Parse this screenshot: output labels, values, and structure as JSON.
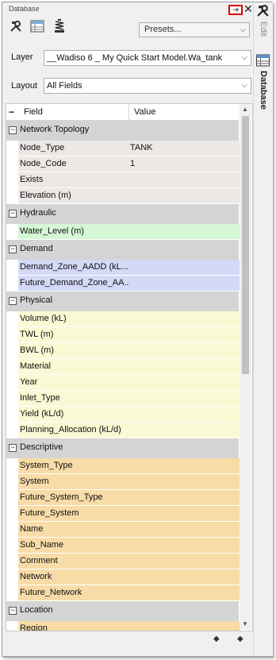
{
  "panel": {
    "title": "Database",
    "pin_symbol": "⇥",
    "close_symbol": "✕",
    "toolbar_icons": [
      "tools-icon",
      "table-icon",
      "spring-icon"
    ],
    "presets_label": "Presets...",
    "layer_label": "Layer",
    "layer_value": "__Wadiso 6 _ My Quick Start Model.Wa_tank",
    "layout_label": "Layout",
    "layout_value": "All Fields"
  },
  "grid": {
    "headers": {
      "collapse": "−",
      "field": "Field",
      "value": "Value"
    },
    "groups": [
      {
        "name": "Network Topology",
        "color": "#ece8e6",
        "rows": [
          {
            "field": "Node_Type",
            "value": "TANK"
          },
          {
            "field": "Node_Code",
            "value": "1"
          },
          {
            "field": "Exists",
            "value": ""
          },
          {
            "field": "Elevation (m)",
            "value": ""
          }
        ]
      },
      {
        "name": "Hydraulic",
        "color": "#d6f7d6",
        "rows": [
          {
            "field": "Water_Level (m)",
            "value": ""
          }
        ]
      },
      {
        "name": "Demand",
        "color": "#d4d9f7",
        "rows": [
          {
            "field": "Demand_Zone_AADD (kL...",
            "value": ""
          },
          {
            "field": "Future_Demand_Zone_AA...",
            "value": ""
          }
        ]
      },
      {
        "name": "Physical",
        "color": "#f9f9d4",
        "rows": [
          {
            "field": "Volume (kL)",
            "value": ""
          },
          {
            "field": "TWL (m)",
            "value": ""
          },
          {
            "field": "BWL (m)",
            "value": ""
          },
          {
            "field": "Material",
            "value": ""
          },
          {
            "field": "Year",
            "value": ""
          },
          {
            "field": "Inlet_Type",
            "value": ""
          },
          {
            "field": "Yield (kL/d)",
            "value": ""
          },
          {
            "field": "Planning_Allocation (kL/d)",
            "value": ""
          }
        ]
      },
      {
        "name": "Descriptive",
        "color": "#f7dca8",
        "rows": [
          {
            "field": "System_Type",
            "value": ""
          },
          {
            "field": "System",
            "value": ""
          },
          {
            "field": "Future_System_Type",
            "value": ""
          },
          {
            "field": "Future_System",
            "value": ""
          },
          {
            "field": "Name",
            "value": ""
          },
          {
            "field": "Sub_Name",
            "value": ""
          },
          {
            "field": "Comment",
            "value": ""
          },
          {
            "field": "Network",
            "value": ""
          },
          {
            "field": "Future_Network",
            "value": ""
          }
        ]
      },
      {
        "name": "Location",
        "color": "#f7dca8",
        "rows": [
          {
            "field": "Region",
            "value": ""
          }
        ]
      }
    ]
  },
  "side_tabs": {
    "edit": "Edit",
    "database": "Database"
  },
  "nav": {
    "prev": "◆",
    "next": "◆"
  }
}
